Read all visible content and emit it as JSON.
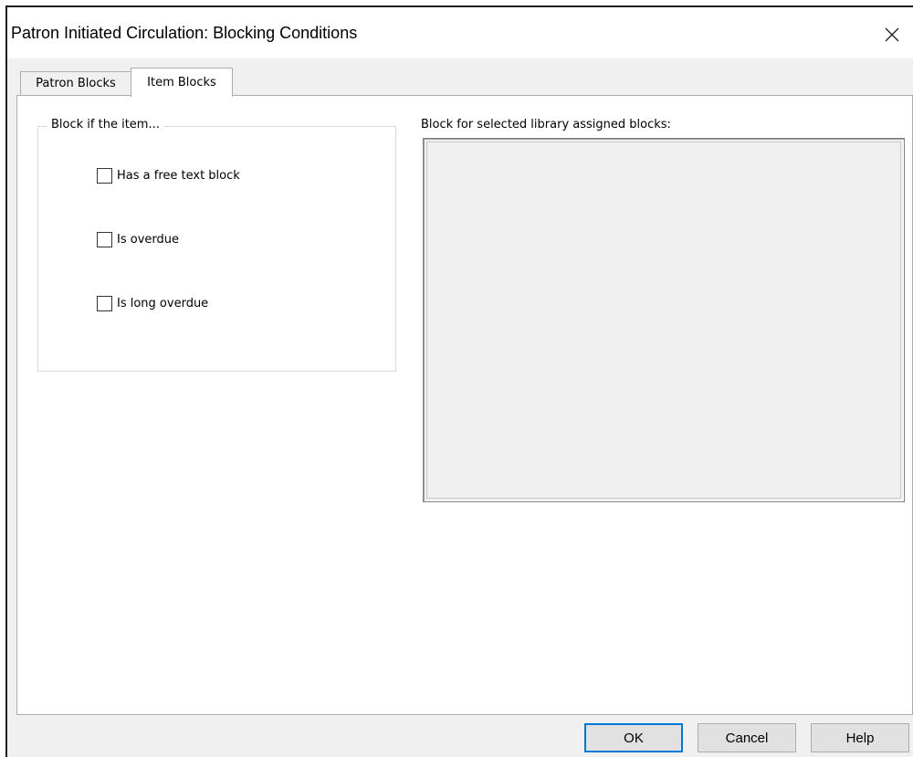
{
  "window": {
    "title": "Patron Initiated Circulation: Blocking Conditions",
    "close_icon": "close-icon"
  },
  "tabs": [
    {
      "label": "Patron Blocks",
      "active": false
    },
    {
      "label": "Item Blocks",
      "active": true
    }
  ],
  "item_blocks": {
    "group_title": "Block if the item...",
    "checkboxes": [
      {
        "label": "Has a free text block",
        "checked": false
      },
      {
        "label": "Is overdue",
        "checked": false
      },
      {
        "label": "Is long overdue",
        "checked": false
      }
    ],
    "list_label": "Block for selected library assigned blocks:",
    "list_items": []
  },
  "buttons": {
    "ok": "OK",
    "cancel": "Cancel",
    "help": "Help"
  },
  "colors": {
    "accent": "#0078d7",
    "dialog_bg": "#f0f0f0"
  }
}
